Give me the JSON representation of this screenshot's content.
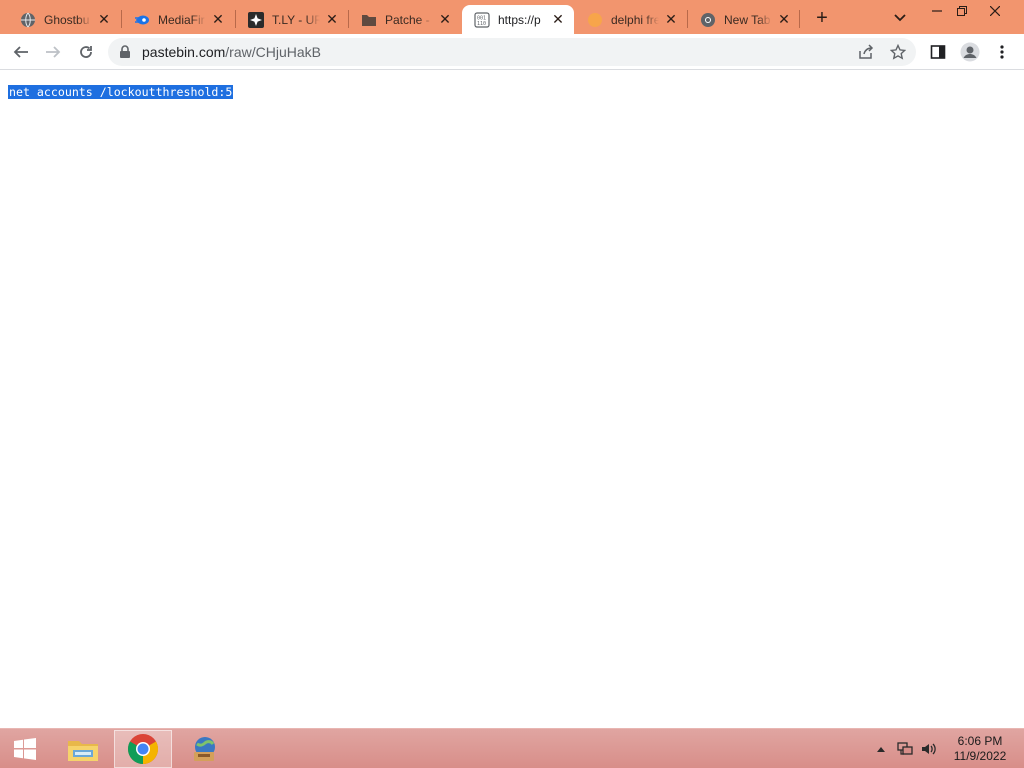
{
  "browser": {
    "tabs": [
      {
        "title": "Ghostbu",
        "favicon": "globe-icon",
        "active": false
      },
      {
        "title": "MediaFir",
        "favicon": "mediafire-icon",
        "active": false
      },
      {
        "title": "T.LY - UR",
        "favicon": "tly-icon",
        "active": false
      },
      {
        "title": "Patche -",
        "favicon": "folder-icon",
        "active": false
      },
      {
        "title": "https://p",
        "favicon": "pastebin-icon",
        "active": true
      },
      {
        "title": "delphi fre",
        "favicon": "orange-dot-icon",
        "active": false
      },
      {
        "title": "New Tab",
        "favicon": "chrome-icon",
        "active": false
      }
    ],
    "close_glyph": "✕",
    "new_tab_glyph": "+",
    "address": {
      "host": "pastebin.com",
      "path": "/raw/CHjuHakB"
    }
  },
  "page": {
    "selected_text": "net accounts /lockoutthreshold:5"
  },
  "taskbar": {
    "time": "6:06 PM",
    "date": "11/9/2022",
    "pinned": [
      {
        "name": "file-explorer",
        "active": false
      },
      {
        "name": "chrome",
        "active": true
      },
      {
        "name": "network-app",
        "active": false
      }
    ]
  },
  "colors": {
    "tabstrip": "#f2956e",
    "selection": "#1e6fe0",
    "taskbar": "#d88e89"
  }
}
